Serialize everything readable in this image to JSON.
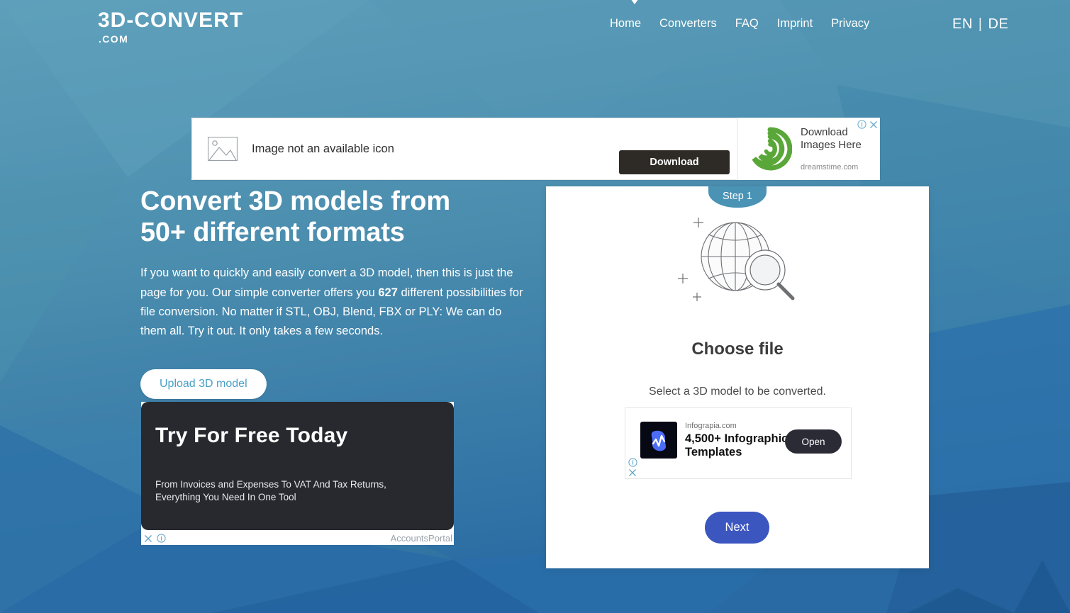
{
  "site": {
    "logo_main": "3D-CONVERT",
    "logo_sub": ".COM"
  },
  "nav": {
    "items": [
      {
        "label": "Home"
      },
      {
        "label": "Converters"
      },
      {
        "label": "FAQ"
      },
      {
        "label": "Imprint"
      },
      {
        "label": "Privacy"
      }
    ],
    "chevron_icon": "chevron-down-icon"
  },
  "language": {
    "active": "EN",
    "separator": "|",
    "alternate": "DE"
  },
  "top_ad": {
    "broken_image_icon": "broken-image-icon",
    "placeholder_text": "Image not an available icon",
    "download_label": "Download",
    "advertiser_icon": "dreamstime-spiral-icon",
    "headline": "Download Images Here",
    "url": "dreamstime.com",
    "info_icon": "adchoices-info-icon",
    "close_icon": "close-icon"
  },
  "hero": {
    "heading_line1": "Convert 3D models from",
    "heading_line2": "50+ different formats",
    "paragraph_part1": "If you want to quickly and easily convert a 3D model, then this is just the page for you. Our simple converter offers you ",
    "paragraph_highlight": "627",
    "paragraph_part2": " different possibilities for file conversion. No matter if STL, OBJ, Blend, FBX or PLY: We can do them all. Try it out. It only takes a few seconds.",
    "upload_button": "Upload 3D model"
  },
  "left_ad": {
    "headline": "Try For Free Today",
    "subtext": "From Invoices and Expenses To VAT And Tax Returns, Everything You Need In One Tool",
    "arrow_icon": "chevron-right-icon",
    "close_icon": "close-icon",
    "info_icon": "adchoices-info-icon",
    "brand": "AccountsPortal"
  },
  "step_card": {
    "step_badge": "Step 1",
    "illustration_icon": "globe-magnifier-icon",
    "title": "Choose file",
    "subtitle": "Select a 3D model to be converted.",
    "next_button": "Next",
    "inner_ad": {
      "logo_icon": "infograpia-logo-icon",
      "domain": "Infograpia.com",
      "headline": "4,500+ Infographic Templates",
      "open_label": "Open",
      "info_icon": "adchoices-info-icon",
      "close_icon": "close-icon"
    }
  },
  "colors": {
    "background_top": "#5b9cb8",
    "background_bottom": "#1d5a96",
    "accent_blue": "#3c56c0",
    "upload_text": "#49a0c6",
    "step_badge": "#4a93b5",
    "dark_ad": "#27292e"
  }
}
